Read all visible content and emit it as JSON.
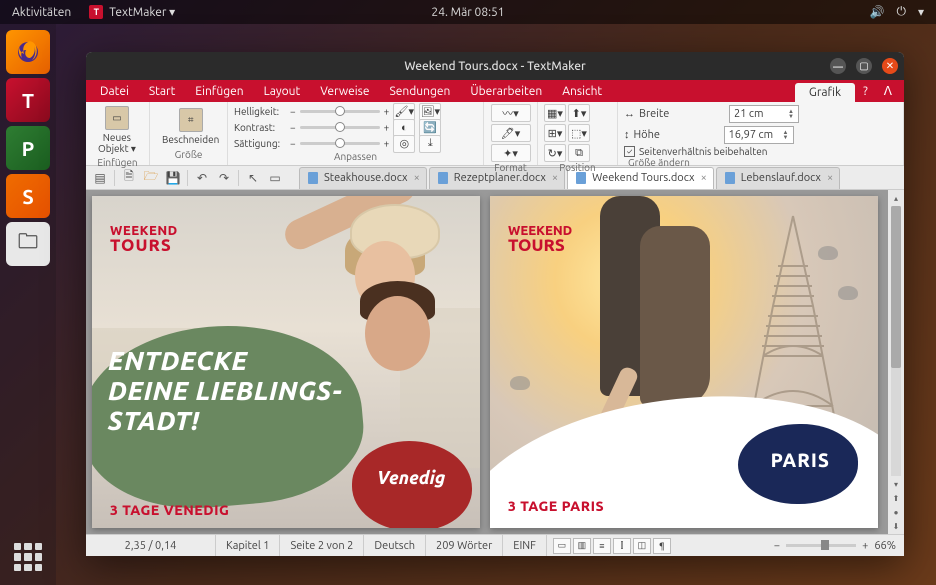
{
  "topbar": {
    "activities": "Aktivitäten",
    "app_icon": "T",
    "app_menu": "TextMaker ▾",
    "datetime": "24. Mär  08:51"
  },
  "window": {
    "title": "Weekend Tours.docx - TextMaker"
  },
  "menubar": {
    "items": [
      "Datei",
      "Start",
      "Einfügen",
      "Layout",
      "Verweise",
      "Sendungen",
      "Überarbeiten",
      "Ansicht"
    ],
    "context": "Grafik",
    "help": "?"
  },
  "ribbon": {
    "insert": {
      "new_object": "Neues\nObjekt ▾",
      "group": "Einfügen"
    },
    "size": {
      "crop": "Beschneiden",
      "group": "Größe"
    },
    "adjust": {
      "brightness": "Helligkeit:",
      "contrast": "Kontrast:",
      "saturation": "Sättigung:",
      "group": "Anpassen"
    },
    "format": {
      "group": "Format"
    },
    "position": {
      "group": "Position"
    },
    "resize": {
      "width_label": "Breite",
      "width_value": "21 cm",
      "height_label": "Höhe",
      "height_value": "16,97 cm",
      "aspect": "Seitenverhältnis beibehalten",
      "group": "Größe ändern"
    }
  },
  "tabs": [
    {
      "label": "Steakhouse.docx",
      "active": false
    },
    {
      "label": "Rezeptplaner.docx",
      "active": false
    },
    {
      "label": "Weekend Tours.docx",
      "active": true
    },
    {
      "label": "Lebenslauf.docx",
      "active": false
    }
  ],
  "page1": {
    "logo1": "WEEKEND",
    "logo2": "TOURS",
    "headline": "ENTDECKE\nDEINE LIEBLINGS-\nSTADT!",
    "badge": "Venedig",
    "bottom": "3 TAGE VENEDIG"
  },
  "page2": {
    "logo1": "WEEKEND",
    "logo2": "TOURS",
    "badge": "PARIS",
    "bottom": "3 TAGE PARIS"
  },
  "statusbar": {
    "pos": "2,35 / 0,14",
    "chapter": "Kapitel 1",
    "page": "Seite 2 von 2",
    "lang": "Deutsch",
    "words": "209 Wörter",
    "mode": "EINF",
    "zoom": "66%"
  }
}
